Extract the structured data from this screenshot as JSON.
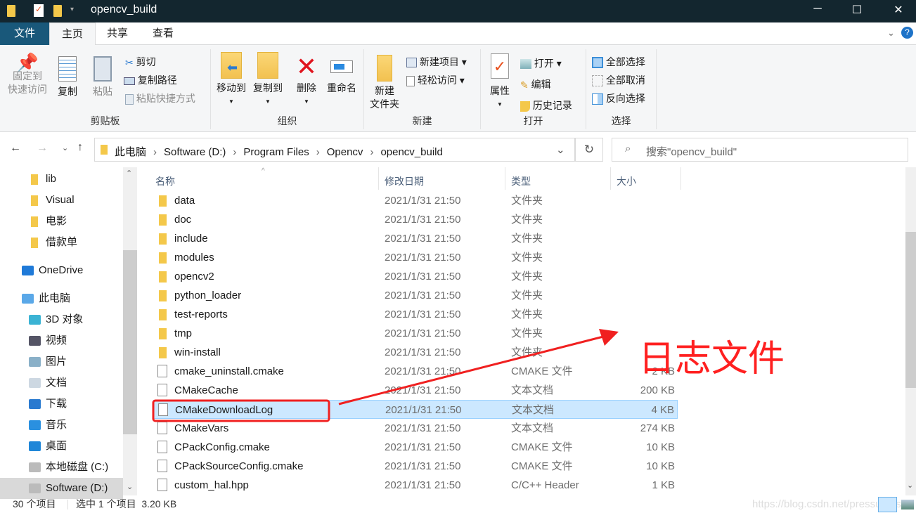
{
  "window": {
    "title": "opencv_build",
    "controls": [
      "─",
      "☐",
      "✕"
    ]
  },
  "ribbon_tabs": [
    "文件",
    "主页",
    "共享",
    "查看"
  ],
  "ribbon": {
    "clipboard": {
      "label": "剪贴板",
      "pin": "固定到\n快速访问",
      "copy": "复制",
      "paste": "粘贴",
      "cut": "剪切",
      "copy_path": "复制路径",
      "paste_shortcut": "粘贴快捷方式"
    },
    "organize": {
      "label": "组织",
      "move_to": "移动到",
      "copy_to": "复制到",
      "delete": "删除",
      "rename": "重命名"
    },
    "new": {
      "label": "新建",
      "new_folder": "新建\n文件夹",
      "new_item": "新建项目",
      "easy_access": "轻松访问"
    },
    "open": {
      "label": "打开",
      "properties": "属性",
      "open": "打开",
      "edit": "编辑",
      "history": "历史记录"
    },
    "select": {
      "label": "选择",
      "select_all": "全部选择",
      "select_none": "全部取消",
      "invert": "反向选择"
    }
  },
  "address": {
    "crumbs": [
      "此电脑",
      "Software (D:)",
      "Program Files",
      "Opencv",
      "opencv_build"
    ],
    "search_placeholder": "搜索\"opencv_build\""
  },
  "nav": [
    {
      "label": "lib",
      "icon": "folder-icon"
    },
    {
      "label": "Visual",
      "icon": "folder-icon"
    },
    {
      "label": "电影",
      "icon": "folder-icon"
    },
    {
      "label": "借款单",
      "icon": "folder-icon"
    },
    {
      "label": "OneDrive",
      "icon": "cloud-icon"
    },
    {
      "label": "此电脑",
      "icon": "computer-icon"
    },
    {
      "label": "3D 对象",
      "icon": "cube-icon"
    },
    {
      "label": "视频",
      "icon": "video-icon"
    },
    {
      "label": "图片",
      "icon": "picture-icon"
    },
    {
      "label": "文档",
      "icon": "document-icon"
    },
    {
      "label": "下载",
      "icon": "download-icon"
    },
    {
      "label": "音乐",
      "icon": "music-icon"
    },
    {
      "label": "桌面",
      "icon": "desktop-icon"
    },
    {
      "label": "本地磁盘 (C:)",
      "icon": "drive-icon"
    },
    {
      "label": "Software (D:)",
      "icon": "drive-icon"
    }
  ],
  "columns": [
    "名称",
    "修改日期",
    "类型",
    "大小"
  ],
  "files": [
    {
      "name": "data",
      "date": "2021/1/31 21:50",
      "type": "文件夹",
      "size": ""
    },
    {
      "name": "doc",
      "date": "2021/1/31 21:50",
      "type": "文件夹",
      "size": ""
    },
    {
      "name": "include",
      "date": "2021/1/31 21:50",
      "type": "文件夹",
      "size": ""
    },
    {
      "name": "modules",
      "date": "2021/1/31 21:50",
      "type": "文件夹",
      "size": ""
    },
    {
      "name": "opencv2",
      "date": "2021/1/31 21:50",
      "type": "文件夹",
      "size": ""
    },
    {
      "name": "python_loader",
      "date": "2021/1/31 21:50",
      "type": "文件夹",
      "size": ""
    },
    {
      "name": "test-reports",
      "date": "2021/1/31 21:50",
      "type": "文件夹",
      "size": ""
    },
    {
      "name": "tmp",
      "date": "2021/1/31 21:50",
      "type": "文件夹",
      "size": ""
    },
    {
      "name": "win-install",
      "date": "2021/1/31 21:50",
      "type": "文件夹",
      "size": ""
    },
    {
      "name": "cmake_uninstall.cmake",
      "date": "2021/1/31 21:50",
      "type": "CMAKE 文件",
      "size": "2 KB"
    },
    {
      "name": "CMakeCache",
      "date": "2021/1/31 21:50",
      "type": "文本文档",
      "size": "200 KB"
    },
    {
      "name": "CMakeDownloadLog",
      "date": "2021/1/31 21:50",
      "type": "文本文档",
      "size": "4 KB",
      "selected": true
    },
    {
      "name": "CMakeVars",
      "date": "2021/1/31 21:50",
      "type": "文本文档",
      "size": "274 KB"
    },
    {
      "name": "CPackConfig.cmake",
      "date": "2021/1/31 21:50",
      "type": "CMAKE 文件",
      "size": "10 KB"
    },
    {
      "name": "CPackSourceConfig.cmake",
      "date": "2021/1/31 21:50",
      "type": "CMAKE 文件",
      "size": "10 KB"
    },
    {
      "name": "custom_hal.hpp",
      "date": "2021/1/31 21:50",
      "type": "C/C++ Header",
      "size": "1 KB"
    }
  ],
  "annotation": {
    "text": "日志文件",
    "color": "#ff2020"
  },
  "status": {
    "count": "30 个项目",
    "selected": "选中 1 个项目  3.20 KB"
  },
  "watermark": "https://blog.csdn.net/pressuress",
  "colors": {
    "titlebar": "#13262f",
    "selection": "#cce8ff",
    "file_tab": "#19587a"
  }
}
